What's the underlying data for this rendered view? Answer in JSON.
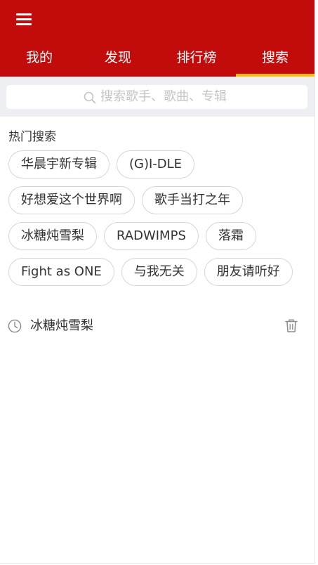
{
  "header": {
    "menu_icon": "hamburger-menu-icon",
    "tabs": [
      {
        "label": "我的",
        "active": false
      },
      {
        "label": "发现",
        "active": false
      },
      {
        "label": "排行榜",
        "active": false
      },
      {
        "label": "搜索",
        "active": true
      }
    ]
  },
  "search": {
    "icon": "search-icon",
    "placeholder": "搜索歌手、歌曲、专辑"
  },
  "hot": {
    "title": "热门搜索",
    "tags": [
      "华晨宇新专辑",
      "(G)I-DLE",
      "好想爱这个世界啊",
      "歌手当打之年",
      "冰糖炖雪梨",
      "RADWIMPS",
      "落霜",
      "Fight as ONE",
      "与我无关",
      "朋友请听好"
    ]
  },
  "history": {
    "items": [
      {
        "icon": "clock-icon",
        "text": "冰糖炖雪梨",
        "delete_icon": "trash-icon"
      }
    ]
  },
  "colors": {
    "brand_red": "#c20c0c",
    "active_tab_indicator": "#ffbf00",
    "search_bg": "#eeeff3",
    "placeholder": "#c4c4c4"
  }
}
